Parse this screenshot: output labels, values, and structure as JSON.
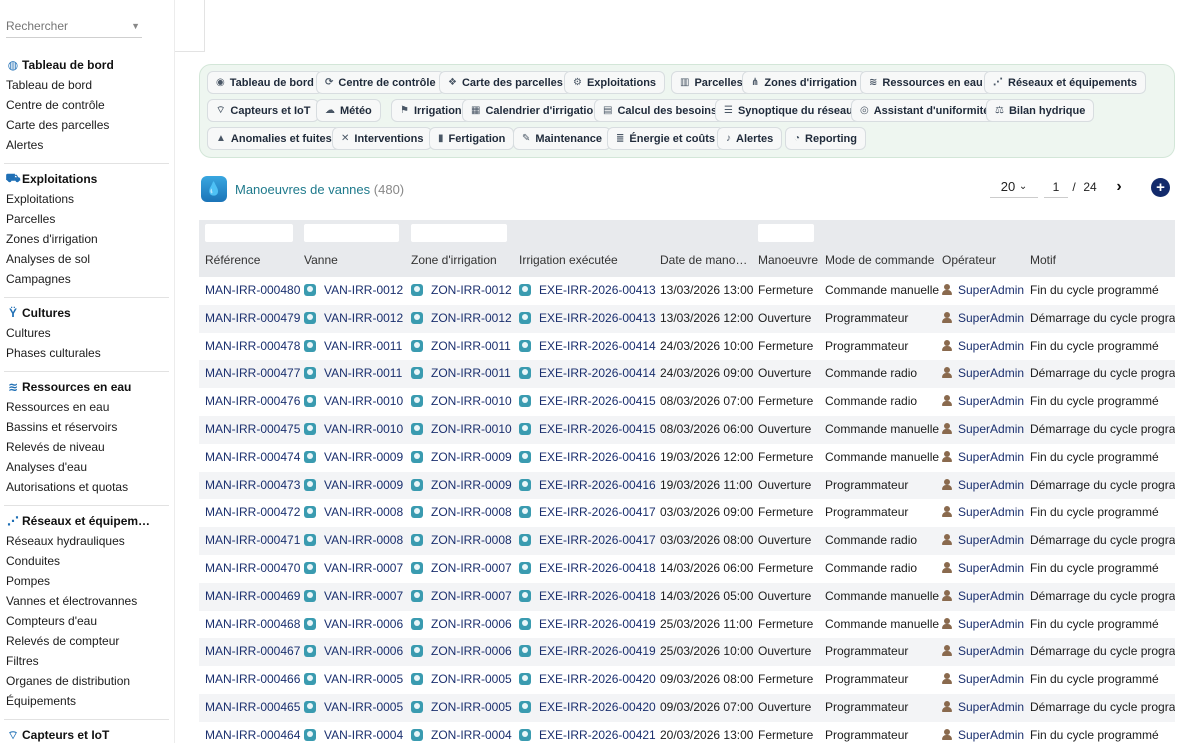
{
  "search": {
    "placeholder": "Rechercher"
  },
  "sidebar": [
    {
      "title": "Tableau de bord",
      "icon": "dashboard-icon",
      "items": [
        "Tableau de bord",
        "Centre de contrôle",
        "Carte des parcelles",
        "Alertes"
      ]
    },
    {
      "title": "Exploitations",
      "icon": "tractor-icon",
      "items": [
        "Exploitations",
        "Parcelles",
        "Zones d'irrigation",
        "Analyses de sol",
        "Campagnes"
      ]
    },
    {
      "title": "Cultures",
      "icon": "sprout-icon",
      "items": [
        "Cultures",
        "Phases culturales"
      ]
    },
    {
      "title": "Ressources en eau",
      "icon": "water-icon",
      "items": [
        "Ressources en eau",
        "Bassins et réservoirs",
        "Relevés de niveau",
        "Analyses d'eau",
        "Autorisations et quotas"
      ]
    },
    {
      "title": "Réseaux et équipem…",
      "icon": "network-icon",
      "items": [
        "Réseaux hydrauliques",
        "Conduites",
        "Pompes",
        "Vannes et électrovannes",
        "Compteurs d'eau",
        "Relevés de compteur",
        "Filtres",
        "Organes de distribution",
        "Équipements"
      ]
    },
    {
      "title": "Capteurs et IoT",
      "icon": "sensor-icon",
      "items": []
    }
  ],
  "nav": [
    {
      "label": "Tableau de bord",
      "glyph": "◉"
    },
    {
      "label": "Centre de contrôle",
      "glyph": "⟳"
    },
    {
      "label": "Carte des parcelles",
      "glyph": "❖"
    },
    {
      "label": "Exploitations",
      "glyph": "⚙"
    },
    {
      "label": "Parcelles",
      "glyph": "▥"
    },
    {
      "label": "Zones d'irrigation",
      "glyph": "⋔"
    },
    {
      "label": "Ressources en eau",
      "glyph": "≋"
    },
    {
      "label": "Réseaux et équipements",
      "glyph": "⋰"
    },
    {
      "label": "Capteurs et IoT",
      "glyph": "⌔"
    },
    {
      "label": "Météo",
      "glyph": "☁"
    },
    {
      "label": "Irrigation",
      "glyph": "⚑"
    },
    {
      "label": "Calendrier d'irrigation",
      "glyph": "▦"
    },
    {
      "label": "Calcul des besoins",
      "glyph": "▤"
    },
    {
      "label": "Synoptique du réseau",
      "glyph": "☰"
    },
    {
      "label": "Assistant d'uniformité",
      "glyph": "◎"
    },
    {
      "label": "Bilan hydrique",
      "glyph": "⚖"
    },
    {
      "label": "Anomalies et fuites",
      "glyph": "▲"
    },
    {
      "label": "Interventions",
      "glyph": "✕"
    },
    {
      "label": "Fertigation",
      "glyph": "▮"
    },
    {
      "label": "Maintenance",
      "glyph": "✎"
    },
    {
      "label": "Énergie et coûts",
      "glyph": "≣"
    },
    {
      "label": "Alertes",
      "glyph": "♪"
    },
    {
      "label": "Reporting",
      "glyph": "◔"
    }
  ],
  "page": {
    "title": "Manoeuvres de vannes",
    "count": "(480)"
  },
  "pagination": {
    "page_size": "20",
    "current_page": "1",
    "separator": "/",
    "total_pages": "24"
  },
  "columns": [
    "Référence",
    "Vanne",
    "Zone d'irrigation",
    "Irrigation exécutée",
    "Date de mano…",
    "Manoeuvre",
    "Mode de commande",
    "Opérateur",
    "Motif"
  ],
  "rows": [
    [
      "MAN-IRR-000480",
      "VAN-IRR-0012",
      "ZON-IRR-0012",
      "EXE-IRR-2026-00413",
      "13/03/2026 13:00",
      "Fermeture",
      "Commande manuelle",
      "SuperAdmin",
      "Fin du cycle programmé"
    ],
    [
      "MAN-IRR-000479",
      "VAN-IRR-0012",
      "ZON-IRR-0012",
      "EXE-IRR-2026-00413",
      "13/03/2026 12:00",
      "Ouverture",
      "Programmateur",
      "SuperAdmin",
      "Démarrage du cycle progra…"
    ],
    [
      "MAN-IRR-000478",
      "VAN-IRR-0011",
      "ZON-IRR-0011",
      "EXE-IRR-2026-00414",
      "24/03/2026 10:00",
      "Fermeture",
      "Programmateur",
      "SuperAdmin",
      "Fin du cycle programmé"
    ],
    [
      "MAN-IRR-000477",
      "VAN-IRR-0011",
      "ZON-IRR-0011",
      "EXE-IRR-2026-00414",
      "24/03/2026 09:00",
      "Ouverture",
      "Commande radio",
      "SuperAdmin",
      "Démarrage du cycle progra…"
    ],
    [
      "MAN-IRR-000476",
      "VAN-IRR-0010",
      "ZON-IRR-0010",
      "EXE-IRR-2026-00415",
      "08/03/2026 07:00",
      "Fermeture",
      "Commande radio",
      "SuperAdmin",
      "Fin du cycle programmé"
    ],
    [
      "MAN-IRR-000475",
      "VAN-IRR-0010",
      "ZON-IRR-0010",
      "EXE-IRR-2026-00415",
      "08/03/2026 06:00",
      "Ouverture",
      "Commande manuelle",
      "SuperAdmin",
      "Démarrage du cycle progra…"
    ],
    [
      "MAN-IRR-000474",
      "VAN-IRR-0009",
      "ZON-IRR-0009",
      "EXE-IRR-2026-00416",
      "19/03/2026 12:00",
      "Fermeture",
      "Commande manuelle",
      "SuperAdmin",
      "Fin du cycle programmé"
    ],
    [
      "MAN-IRR-000473",
      "VAN-IRR-0009",
      "ZON-IRR-0009",
      "EXE-IRR-2026-00416",
      "19/03/2026 11:00",
      "Ouverture",
      "Programmateur",
      "SuperAdmin",
      "Démarrage du cycle progra…"
    ],
    [
      "MAN-IRR-000472",
      "VAN-IRR-0008",
      "ZON-IRR-0008",
      "EXE-IRR-2026-00417",
      "03/03/2026 09:00",
      "Fermeture",
      "Programmateur",
      "SuperAdmin",
      "Fin du cycle programmé"
    ],
    [
      "MAN-IRR-000471",
      "VAN-IRR-0008",
      "ZON-IRR-0008",
      "EXE-IRR-2026-00417",
      "03/03/2026 08:00",
      "Ouverture",
      "Commande radio",
      "SuperAdmin",
      "Démarrage du cycle progra…"
    ],
    [
      "MAN-IRR-000470",
      "VAN-IRR-0007",
      "ZON-IRR-0007",
      "EXE-IRR-2026-00418",
      "14/03/2026 06:00",
      "Fermeture",
      "Commande radio",
      "SuperAdmin",
      "Fin du cycle programmé"
    ],
    [
      "MAN-IRR-000469",
      "VAN-IRR-0007",
      "ZON-IRR-0007",
      "EXE-IRR-2026-00418",
      "14/03/2026 05:00",
      "Ouverture",
      "Commande manuelle",
      "SuperAdmin",
      "Démarrage du cycle progra…"
    ],
    [
      "MAN-IRR-000468",
      "VAN-IRR-0006",
      "ZON-IRR-0006",
      "EXE-IRR-2026-00419",
      "25/03/2026 11:00",
      "Fermeture",
      "Commande manuelle",
      "SuperAdmin",
      "Fin du cycle programmé"
    ],
    [
      "MAN-IRR-000467",
      "VAN-IRR-0006",
      "ZON-IRR-0006",
      "EXE-IRR-2026-00419",
      "25/03/2026 10:00",
      "Ouverture",
      "Programmateur",
      "SuperAdmin",
      "Démarrage du cycle progra…"
    ],
    [
      "MAN-IRR-000466",
      "VAN-IRR-0005",
      "ZON-IRR-0005",
      "EXE-IRR-2026-00420",
      "09/03/2026 08:00",
      "Fermeture",
      "Programmateur",
      "SuperAdmin",
      "Fin du cycle programmé"
    ],
    [
      "MAN-IRR-000465",
      "VAN-IRR-0005",
      "ZON-IRR-0005",
      "EXE-IRR-2026-00420",
      "09/03/2026 07:00",
      "Ouverture",
      "Programmateur",
      "SuperAdmin",
      "Démarrage du cycle progra…"
    ],
    [
      "MAN-IRR-000464",
      "VAN-IRR-0004",
      "ZON-IRR-0004",
      "EXE-IRR-2026-00421",
      "20/03/2026 13:00",
      "Fermeture",
      "Programmateur",
      "SuperAdmin",
      "Fin du cycle programmé"
    ]
  ]
}
